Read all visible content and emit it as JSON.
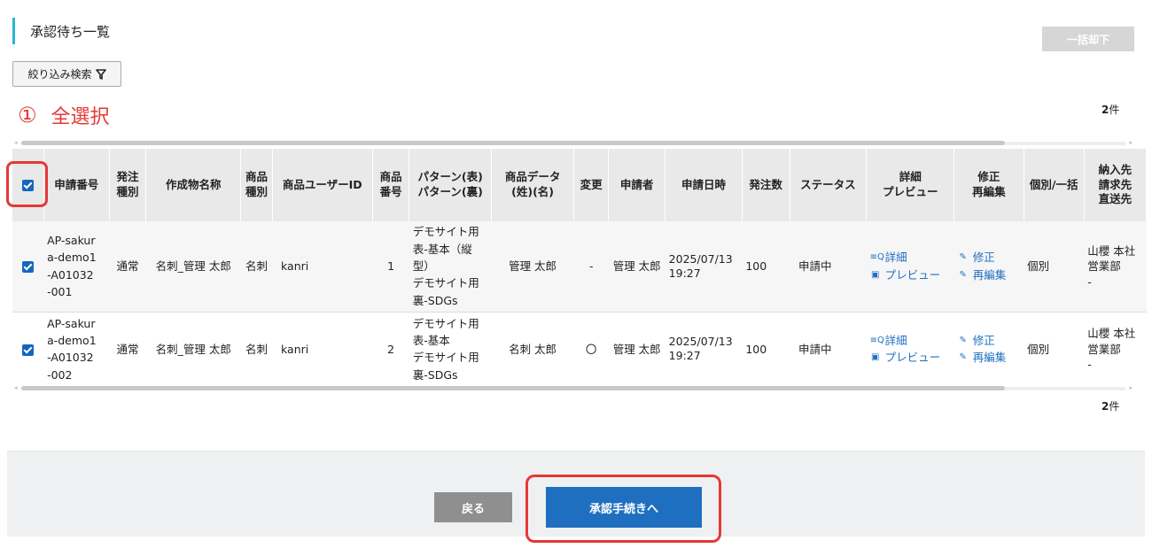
{
  "page": {
    "title": "承認待ち一覧",
    "bulk_reject_label": "一括却下",
    "filter_label": "絞り込み検索",
    "count_label": "件",
    "count_value": "2"
  },
  "annotation": {
    "number": "①",
    "text": "全選択",
    "color": "#e53935"
  },
  "table": {
    "headers": [
      "",
      "申請番号",
      "発注\n種別",
      "作成物名称",
      "商品\n種別",
      "商品ユーザーID",
      "商品\n番号",
      "パターン(表)\nパターン(裏)",
      "商品データ\n(姓)(名)",
      "変更",
      "申請者",
      "申請日時",
      "発注数",
      "ステータス",
      "詳細\nプレビュー",
      "修正\n再編集",
      "個別/一括",
      "納入先\n請求先\n直送先"
    ],
    "rows": [
      {
        "checked": true,
        "application_no": "AP-sakur\na-demo1\n-A01032\n-001",
        "order_type": "通常",
        "product_name": "名刺_管理 太郎",
        "product_type": "名刺",
        "user_id": "kanri",
        "product_no": "1",
        "pattern": "デモサイト用\n表-基本（縦\n型）\nデモサイト用\n裏-SDGs",
        "product_data": "管理 太郎",
        "changed": "-",
        "applicant": "管理 太郎",
        "applied_at": "2025/07/13\n19:27",
        "quantity": "100",
        "status": "申請中",
        "detail_label": "詳細",
        "preview_label": "プレビュー",
        "fix_label": "修正",
        "reedit_label": "再編集",
        "individual_bulk": "個別",
        "delivery": "山櫻 本社\n営業部\n-"
      },
      {
        "checked": true,
        "application_no": "AP-sakur\na-demo1\n-A01032\n-002",
        "order_type": "通常",
        "product_name": "名刺_管理 太郎",
        "product_type": "名刺",
        "user_id": "kanri",
        "product_no": "2",
        "pattern": "デモサイト用\n表-基本\nデモサイト用\n裏-SDGs",
        "product_data": "名刺 太郎",
        "changed": "〇",
        "applicant": "管理 太郎",
        "applied_at": "2025/07/13\n19:27",
        "quantity": "100",
        "status": "申請中",
        "detail_label": "詳細",
        "preview_label": "プレビュー",
        "fix_label": "修正",
        "reedit_label": "再編集",
        "individual_bulk": "個別",
        "delivery": "山櫻 本社\n営業部\n-"
      }
    ]
  },
  "footer": {
    "back_label": "戻る",
    "approve_label": "承認手続きへ"
  },
  "colors": {
    "primary": "#1e6fc0",
    "accent_bar": "#2bb6d6",
    "highlight": "#e53935"
  },
  "icons": {
    "filter": "filter-icon",
    "detail": "detail-search-icon",
    "preview": "preview-icon",
    "fix": "edit-icon",
    "reedit": "edit-icon"
  }
}
